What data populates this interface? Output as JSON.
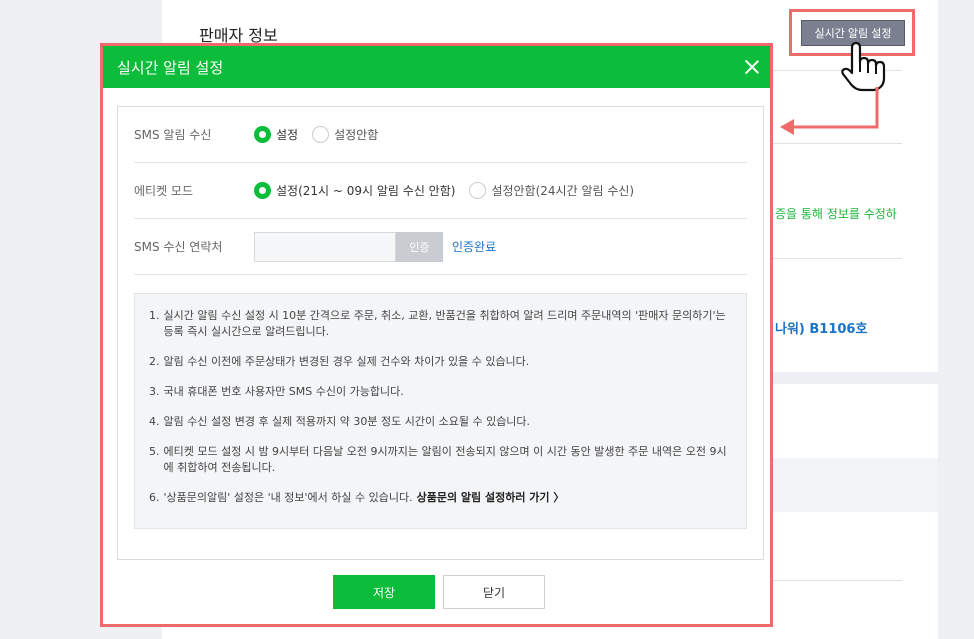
{
  "background": {
    "title": "판매자 정보",
    "green_text": "증을 통해 정보를 수정하",
    "blue_text": "나워) B1106호",
    "top_button": "실시간 알림 설정"
  },
  "modal": {
    "title": "실시간 알림 설정",
    "sms_alert": {
      "label": "SMS 알림 수신",
      "options": [
        "설정",
        "설정안함"
      ],
      "selected": "설정"
    },
    "etiquette": {
      "label": "에티켓 모드",
      "options": [
        "설정(21시 ~ 09시 알림 수신 안함)",
        "설정안함(24시간 알림 수신)"
      ],
      "selected": "설정(21시 ~ 09시 알림 수신 안함)"
    },
    "sms_contact": {
      "label": "SMS 수신 연락처",
      "value": "",
      "verify_button": "인증",
      "verified_text": "인증완료"
    },
    "notices": [
      "실시간 알림 수신 설정 시 10분 간격으로 주문, 취소, 교환, 반품건을 취합하여 알려 드리며 주문내역의 '판매자 문의하기'는 등록 즉시 실시간으로 알려드립니다.",
      "알림 수신 이전에 주문상태가 변경된 경우 실제 건수와 차이가 있을 수 있습니다.",
      "국내 휴대폰 번호 사용자만 SMS 수신이 가능합니다.",
      "알림 수신 설정 변경 후 실제 적용까지 약 30분 정도 시간이 소요될 수 있습니다.",
      "에티켓 모드 설정 시 밤 9시부터 다음날 오전 9시까지는 알림이 전송되지 않으며 이 시간 동안 발생한 주문 내역은 오전 9시에 취합하여 전송됩니다.",
      "'상품문의알림' 설정은 '내 정보'에서 하실 수 있습니다."
    ],
    "notice_numbers": [
      "1.",
      "2.",
      "3.",
      "4.",
      "5.",
      "6."
    ],
    "notice_link": "상품문의 알림 설정하러 가기 〉",
    "save_button": "저장",
    "close_button": "닫기"
  },
  "colors": {
    "accent_green": "#0bbd3a",
    "highlight_red": "#ef6b6b",
    "link_blue": "#1a73c7"
  },
  "icons": [
    "close-icon",
    "pointer-hand-icon",
    "arrow-icon",
    "radio-selected-icon",
    "radio-unselected-icon"
  ]
}
